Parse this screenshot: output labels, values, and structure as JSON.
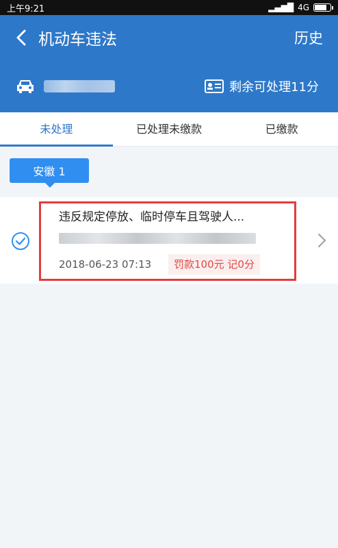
{
  "status_bar": {
    "time": "上午9:21",
    "network": "4G"
  },
  "header": {
    "title": "机动车违法",
    "history_label": "历史",
    "points_label": "剩余可处理11分"
  },
  "tabs": [
    {
      "label": "未处理",
      "active": true
    },
    {
      "label": "已处理未缴款",
      "active": false
    },
    {
      "label": "已缴款",
      "active": false
    }
  ],
  "region_chip": {
    "label": "安徽 1"
  },
  "violation": {
    "title": "违反规定停放、临时停车且驾驶人...",
    "datetime": "2018-06-23 07:13",
    "penalty": "罚款100元 记0分"
  },
  "colors": {
    "brand_blue": "#2e78c9",
    "chip_blue": "#2f8ef0",
    "alert_red": "#e33b3b"
  }
}
